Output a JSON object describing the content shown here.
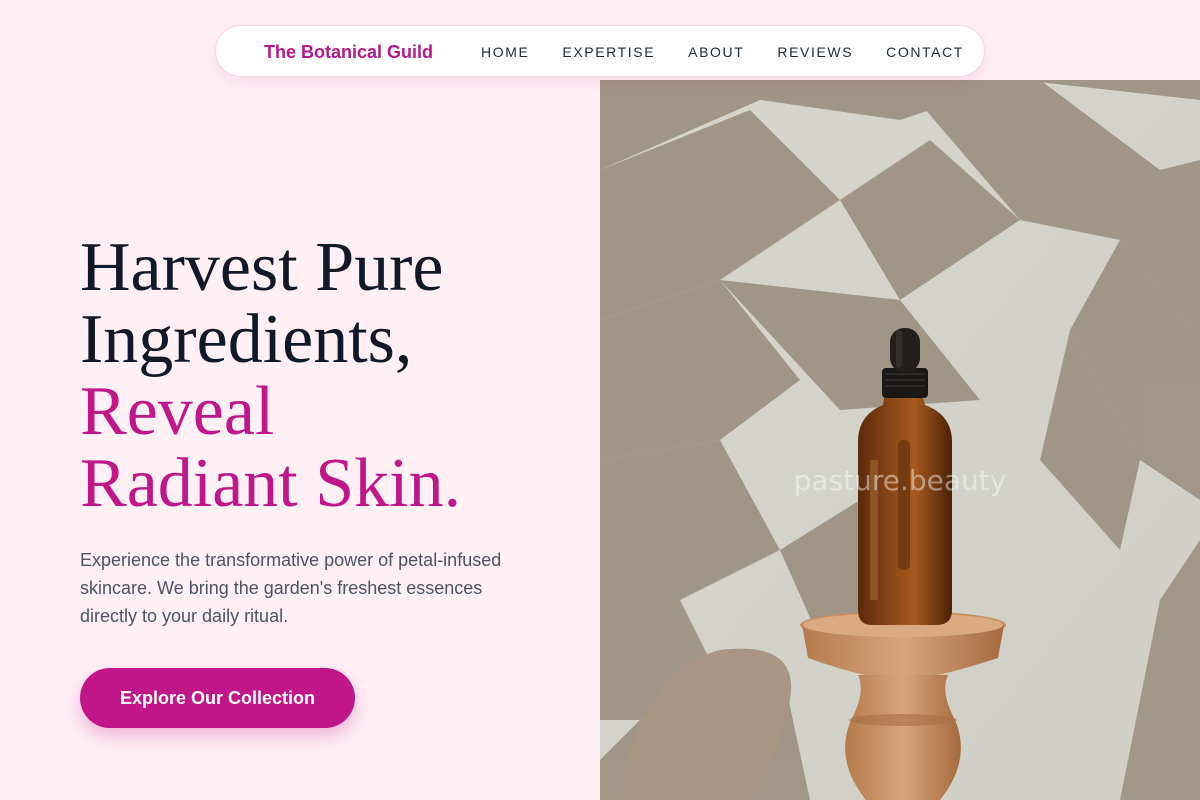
{
  "nav": {
    "brand": "The Botanical Guild",
    "links": [
      "HOME",
      "EXPERTISE",
      "ABOUT",
      "REVIEWS",
      "CONTACT"
    ]
  },
  "hero": {
    "headline_line1": "Harvest Pure",
    "headline_line2": "Ingredients,",
    "headline_accent_line1": "Reveal",
    "headline_accent_line2": "Radiant Skin.",
    "subtitle": "Experience the transformative power of petal-infused skincare. We bring the garden's freshest essences directly to your daily ritual.",
    "cta_label": "Explore Our Collection",
    "image_watermark": "pasture.beauty"
  },
  "colors": {
    "accent": "#c0168a",
    "background": "#fff0f5",
    "heading": "#111827",
    "body_text": "#4b5563"
  }
}
